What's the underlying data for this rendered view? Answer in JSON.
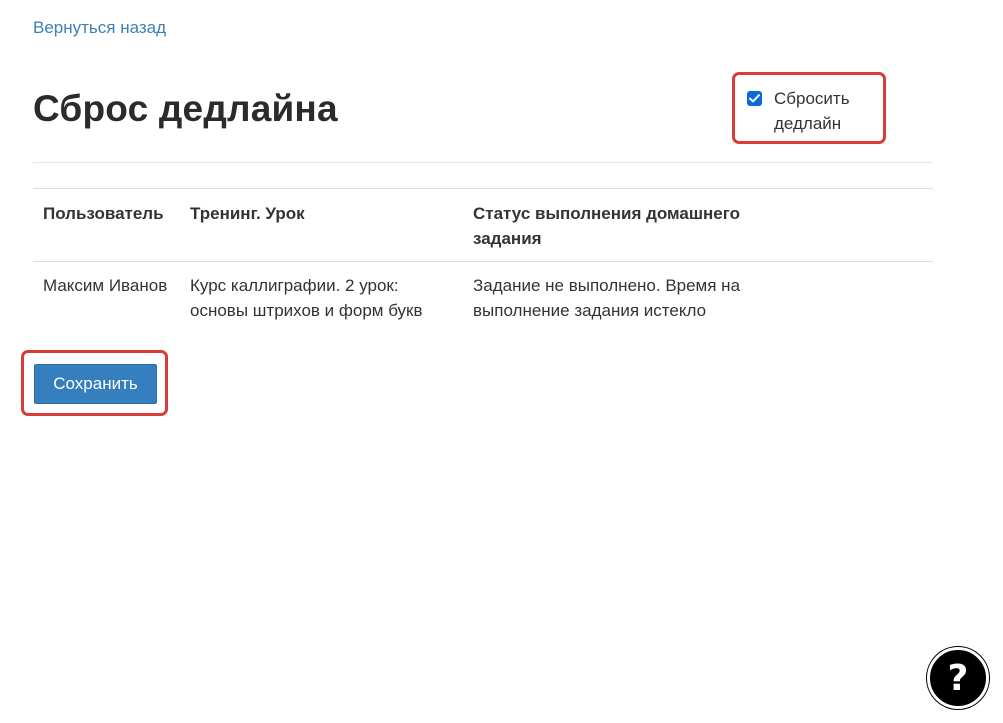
{
  "nav": {
    "back_label": "Вернуться назад"
  },
  "page": {
    "title": "Сброс дедлайна"
  },
  "table": {
    "headers": [
      "Пользователь",
      "Тренинг. Урок",
      "Статус выполнения домашнего задания",
      ""
    ],
    "rows": [
      {
        "user": "Максим Иванов",
        "training": "Курс каллиграфии. 2 урок: основы штрихов и форм букв",
        "status": "Задание не выполнено. Время на выполнение задания истекло",
        "reset_label": "Сбросить дедлайн",
        "reset_checked": true
      }
    ]
  },
  "actions": {
    "save_label": "Сохранить"
  },
  "help": {
    "label": "?",
    "icon": "question-icon"
  },
  "colors": {
    "link": "#3f7fb6",
    "primary_button": "#367fbf",
    "highlight": "#d63d36",
    "checkbox": "#0b6bd6"
  }
}
